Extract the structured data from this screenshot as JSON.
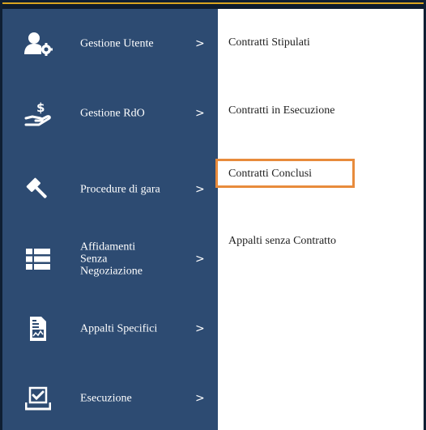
{
  "sidebar": {
    "items": [
      {
        "label": "Gestione Utente",
        "icon": "user-gear-icon",
        "chevron": ">"
      },
      {
        "label": "Gestione RdO",
        "icon": "hand-dollar-icon",
        "chevron": ">"
      },
      {
        "label": "Procedure di gara",
        "icon": "gavel-icon",
        "chevron": ">"
      },
      {
        "label_lines": [
          "Affidamenti",
          "Senza",
          "Negoziazione"
        ],
        "icon": "list-icon",
        "chevron": ">"
      },
      {
        "label": "Appalti Specifici",
        "icon": "document-chart-icon",
        "chevron": ">"
      },
      {
        "label": "Esecuzione",
        "icon": "checkbox-tray-icon",
        "chevron": ">"
      }
    ]
  },
  "submenu": {
    "items": [
      {
        "label": "Contratti Stipulati"
      },
      {
        "label": "Contratti in Esecuzione"
      },
      {
        "label": "Contratti Conclusi"
      },
      {
        "label": "Appalti senza Contratto"
      }
    ]
  },
  "colors": {
    "sidebar_bg": "#2d4b72",
    "highlight_border": "#e88b3c",
    "top_accent": "#d9a520"
  }
}
